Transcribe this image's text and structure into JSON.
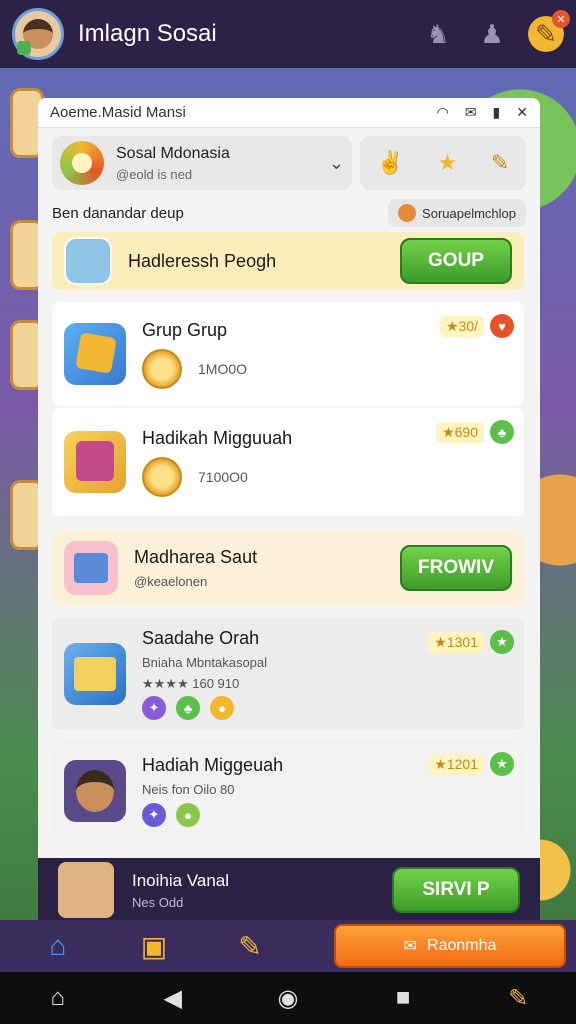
{
  "header": {
    "title": "Imlagn Sosai"
  },
  "modal": {
    "title": "Aoeme.Masid Mansi",
    "profile": {
      "name": "Sosal Mdonasia",
      "sub": "@eold is ned"
    },
    "filter_label": "Ben danandar deup",
    "filter_chip": "Soruapelmchlop"
  },
  "rows": [
    {
      "title": "Hadleressh Peogh",
      "button": "GOUP"
    },
    {
      "title": "Grup Grup",
      "score": "★30/",
      "coin_value": "1MO0O"
    },
    {
      "title": "Hadikah Migguuah",
      "score": "★690",
      "coin_value": "7100O0"
    },
    {
      "title": "Madharea Saut",
      "sub": "@keaelonen",
      "button": "FROWIV"
    },
    {
      "title": "Saadahe Orah",
      "sub": "Bniaha Mbntakasopal",
      "sub2": "★★★★ 160 910",
      "score": "★1301"
    },
    {
      "title": "Hadiah Miggeuah",
      "sub": "Neis fon Oilo 80",
      "score": "★1201"
    }
  ],
  "bottom_strip": {
    "name": "Inoihia Vanal",
    "sub": "Nes Odd",
    "button": "SIRVI P"
  },
  "nav": {
    "cta_label": "Raonmha"
  },
  "colors": {
    "accent_green": "#4caf50",
    "accent_orange": "#f06a12",
    "bar_purple": "#2c2146"
  }
}
